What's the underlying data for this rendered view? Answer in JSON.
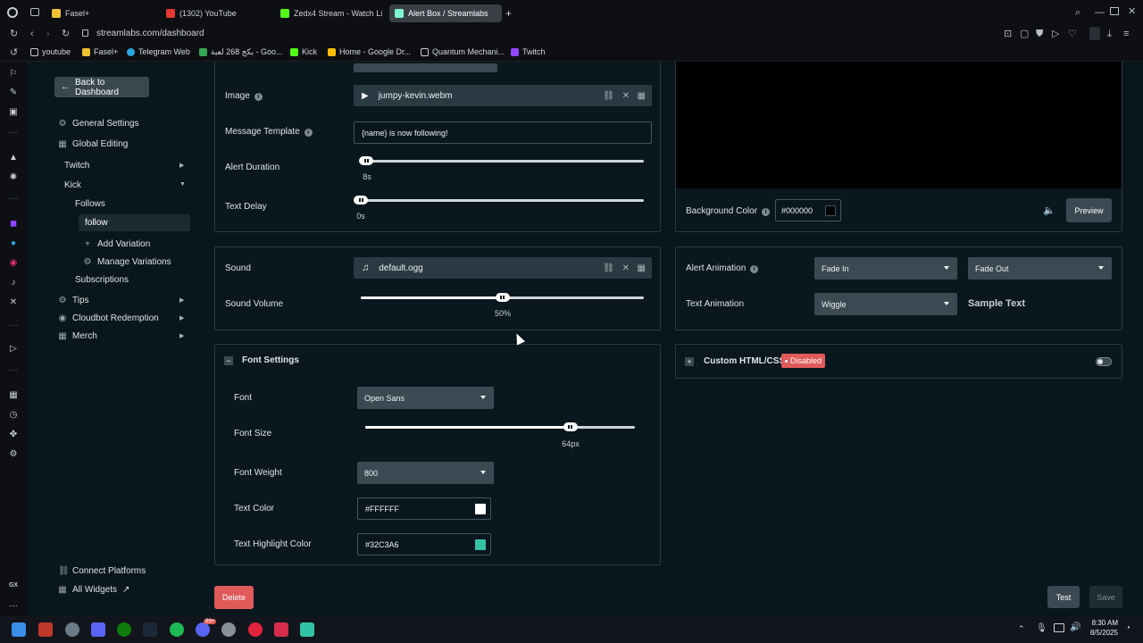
{
  "browser": {
    "tabs": [
      {
        "label": "Fasel+",
        "color": "#f1c232"
      },
      {
        "label": "(1302) YouTube",
        "color": "#e53935"
      },
      {
        "label": "Zedx4 Stream - Watch Li",
        "color": "#53fc18"
      },
      {
        "label": "Alert Box / Streamlabs",
        "color": "#80f5d2"
      }
    ],
    "new_tab_label": "+",
    "url": "streamlabs.com/dashboard",
    "bookmarks": [
      {
        "label": "youtube",
        "color": "#c9cdd2"
      },
      {
        "label": "Fasel+",
        "color": "#f1c232"
      },
      {
        "label": "Telegram Web",
        "color": "#2aa7e0"
      },
      {
        "label": "بكج 268 لعبة - Goo...",
        "color": "#34a853"
      },
      {
        "label": "Kick",
        "color": "#53fc18"
      },
      {
        "label": "Home - Google Dr...",
        "color": "#fbbc04"
      },
      {
        "label": "Quantum Mechani...",
        "color": "#c9cdd2"
      },
      {
        "label": "Twitch",
        "color": "#9146ff"
      }
    ],
    "gx_label": "GX"
  },
  "sidebar": {
    "back_label": "Back to Dashboard",
    "general_settings": "General Settings",
    "global_editing": "Global Editing",
    "twitch": "Twitch",
    "kick": "Kick",
    "follows": "Follows",
    "follow": "follow",
    "add_variation": "Add Variation",
    "manage_variations": "Manage Variations",
    "subscriptions": "Subscriptions",
    "tips": "Tips",
    "cloudbot": "Cloudbot Redemption",
    "merch": "Merch",
    "connect_platforms": "Connect Platforms",
    "all_widgets": "All Widgets"
  },
  "media": {
    "image_label": "Image",
    "image_file": "jumpy-kevin.webm",
    "message_template_label": "Message Template",
    "message_template_value": "{name} is now following!",
    "alert_duration_label": "Alert Duration",
    "alert_duration_value": "8s",
    "alert_duration_fraction": 0.02,
    "text_delay_label": "Text Delay",
    "text_delay_value": "0s",
    "text_delay_fraction": 0.0
  },
  "sound": {
    "sound_label": "Sound",
    "sound_file": "default.ogg",
    "volume_label": "Sound Volume",
    "volume_value": "50%",
    "volume_fraction": 0.5
  },
  "font_settings": {
    "title": "Font Settings",
    "collapse_symbol": "−",
    "font_label": "Font",
    "font_value": "Open Sans",
    "size_label": "Font Size",
    "size_value": "64px",
    "size_fraction": 0.76,
    "weight_label": "Font Weight",
    "weight_value": "800",
    "text_color_label": "Text Color",
    "text_color_value": "#FFFFFF",
    "highlight_label": "Text Highlight Color",
    "highlight_value": "#32C3A6"
  },
  "preview": {
    "background_color_label": "Background Color",
    "background_color_value": "#000000",
    "preview_button": "Preview"
  },
  "animation": {
    "alert_animation_label": "Alert Animation",
    "animation_in": "Fade In",
    "animation_out": "Fade Out",
    "text_animation_label": "Text Animation",
    "text_animation_value": "Wiggle",
    "sample_text": "Sample Text"
  },
  "custom_css": {
    "expand_symbol": "+",
    "label": "Custom HTML/CSS",
    "status": "Disabled"
  },
  "footer": {
    "delete_button": "Delete",
    "test_button": "Test",
    "save_button": "Save"
  },
  "taskbar": {
    "time": "8:30 AM",
    "date": "8/5/2025",
    "badge_count": "99+"
  },
  "colors": {
    "accent": "#32C3A6",
    "delete": "#e05a5a",
    "disabled_badge": "#e05a5a"
  }
}
